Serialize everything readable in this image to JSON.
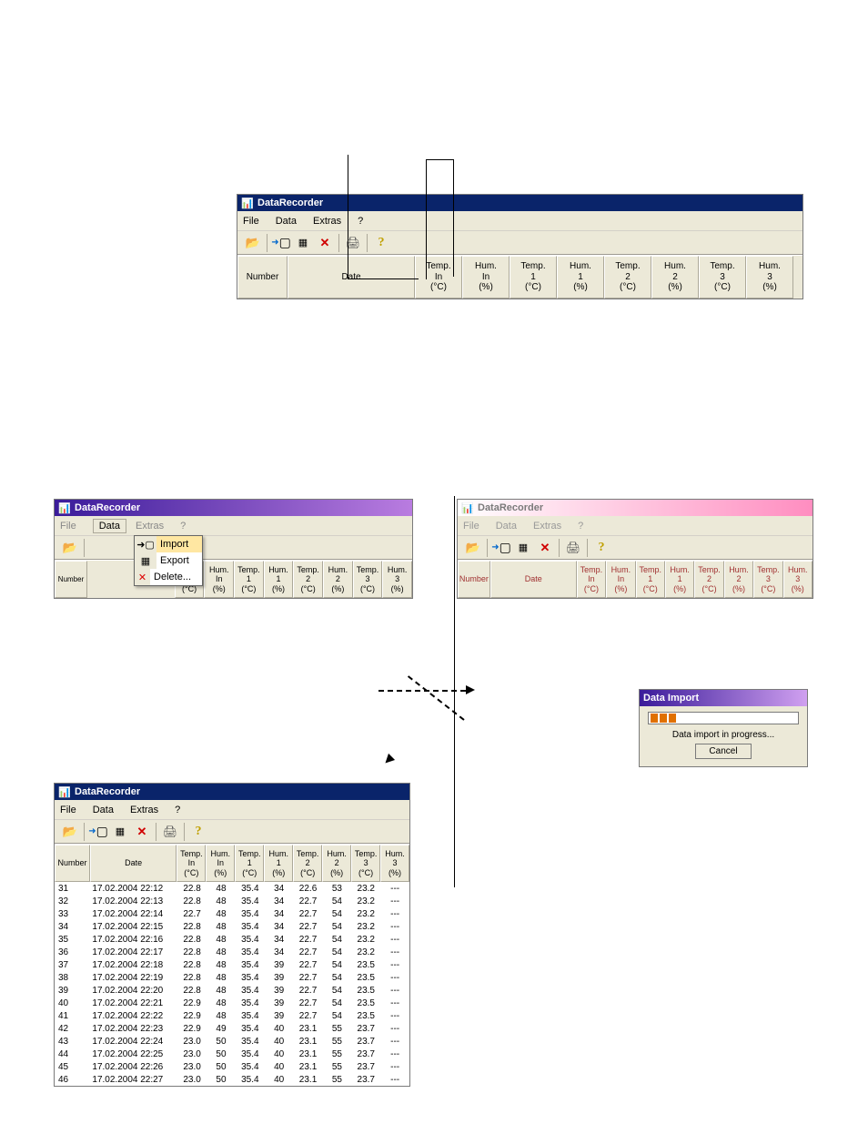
{
  "app_title": "DataRecorder",
  "menu": {
    "file": "File",
    "data": "Data",
    "extras": "Extras",
    "help": "?"
  },
  "toolbar": {
    "open": "open-file",
    "import": "import",
    "export": "export",
    "delete": "delete",
    "print": "print",
    "help": "help"
  },
  "headers": {
    "number": "Number",
    "date": "Date",
    "cols": [
      [
        "Temp.",
        "In",
        "(°C)"
      ],
      [
        "Hum.",
        "In",
        "(%)"
      ],
      [
        "Temp.",
        "1",
        "(°C)"
      ],
      [
        "Hum.",
        "1",
        "(%)"
      ],
      [
        "Temp.",
        "2",
        "(°C)"
      ],
      [
        "Hum.",
        "2",
        "(%)"
      ],
      [
        "Temp.",
        "3",
        "(°C)"
      ],
      [
        "Hum.",
        "3",
        "(%)"
      ]
    ]
  },
  "ctx": {
    "import": "Import",
    "export": "Export",
    "delete": "Delete..."
  },
  "dialog": {
    "title": "Data Import",
    "msg": "Data import in progress...",
    "cancel": "Cancel"
  },
  "rows": [
    {
      "n": "31",
      "d": "17.02.2004 22:12",
      "ti": "22.8",
      "hi": "48",
      "t1": "35.4",
      "h1": "34",
      "t2": "22.6",
      "h2": "53",
      "t3": "23.2",
      "h3": "---"
    },
    {
      "n": "32",
      "d": "17.02.2004 22:13",
      "ti": "22.8",
      "hi": "48",
      "t1": "35.4",
      "h1": "34",
      "t2": "22.7",
      "h2": "54",
      "t3": "23.2",
      "h3": "---"
    },
    {
      "n": "33",
      "d": "17.02.2004 22:14",
      "ti": "22.7",
      "hi": "48",
      "t1": "35.4",
      "h1": "34",
      "t2": "22.7",
      "h2": "54",
      "t3": "23.2",
      "h3": "---"
    },
    {
      "n": "34",
      "d": "17.02.2004 22:15",
      "ti": "22.8",
      "hi": "48",
      "t1": "35.4",
      "h1": "34",
      "t2": "22.7",
      "h2": "54",
      "t3": "23.2",
      "h3": "---"
    },
    {
      "n": "35",
      "d": "17.02.2004 22:16",
      "ti": "22.8",
      "hi": "48",
      "t1": "35.4",
      "h1": "34",
      "t2": "22.7",
      "h2": "54",
      "t3": "23.2",
      "h3": "---"
    },
    {
      "n": "36",
      "d": "17.02.2004 22:17",
      "ti": "22.8",
      "hi": "48",
      "t1": "35.4",
      "h1": "34",
      "t2": "22.7",
      "h2": "54",
      "t3": "23.2",
      "h3": "---"
    },
    {
      "n": "37",
      "d": "17.02.2004 22:18",
      "ti": "22.8",
      "hi": "48",
      "t1": "35.4",
      "h1": "39",
      "t2": "22.7",
      "h2": "54",
      "t3": "23.5",
      "h3": "---"
    },
    {
      "n": "38",
      "d": "17.02.2004 22:19",
      "ti": "22.8",
      "hi": "48",
      "t1": "35.4",
      "h1": "39",
      "t2": "22.7",
      "h2": "54",
      "t3": "23.5",
      "h3": "---"
    },
    {
      "n": "39",
      "d": "17.02.2004 22:20",
      "ti": "22.8",
      "hi": "48",
      "t1": "35.4",
      "h1": "39",
      "t2": "22.7",
      "h2": "54",
      "t3": "23.5",
      "h3": "---"
    },
    {
      "n": "40",
      "d": "17.02.2004 22:21",
      "ti": "22.9",
      "hi": "48",
      "t1": "35.4",
      "h1": "39",
      "t2": "22.7",
      "h2": "54",
      "t3": "23.5",
      "h3": "---"
    },
    {
      "n": "41",
      "d": "17.02.2004 22:22",
      "ti": "22.9",
      "hi": "48",
      "t1": "35.4",
      "h1": "39",
      "t2": "22.7",
      "h2": "54",
      "t3": "23.5",
      "h3": "---"
    },
    {
      "n": "42",
      "d": "17.02.2004 22:23",
      "ti": "22.9",
      "hi": "49",
      "t1": "35.4",
      "h1": "40",
      "t2": "23.1",
      "h2": "55",
      "t3": "23.7",
      "h3": "---"
    },
    {
      "n": "43",
      "d": "17.02.2004 22:24",
      "ti": "23.0",
      "hi": "50",
      "t1": "35.4",
      "h1": "40",
      "t2": "23.1",
      "h2": "55",
      "t3": "23.7",
      "h3": "---"
    },
    {
      "n": "44",
      "d": "17.02.2004 22:25",
      "ti": "23.0",
      "hi": "50",
      "t1": "35.4",
      "h1": "40",
      "t2": "23.1",
      "h2": "55",
      "t3": "23.7",
      "h3": "---"
    },
    {
      "n": "45",
      "d": "17.02.2004 22:26",
      "ti": "23.0",
      "hi": "50",
      "t1": "35.4",
      "h1": "40",
      "t2": "23.1",
      "h2": "55",
      "t3": "23.7",
      "h3": "---"
    },
    {
      "n": "46",
      "d": "17.02.2004 22:27",
      "ti": "23.0",
      "hi": "50",
      "t1": "35.4",
      "h1": "40",
      "t2": "23.1",
      "h2": "55",
      "t3": "23.7",
      "h3": "---"
    }
  ]
}
